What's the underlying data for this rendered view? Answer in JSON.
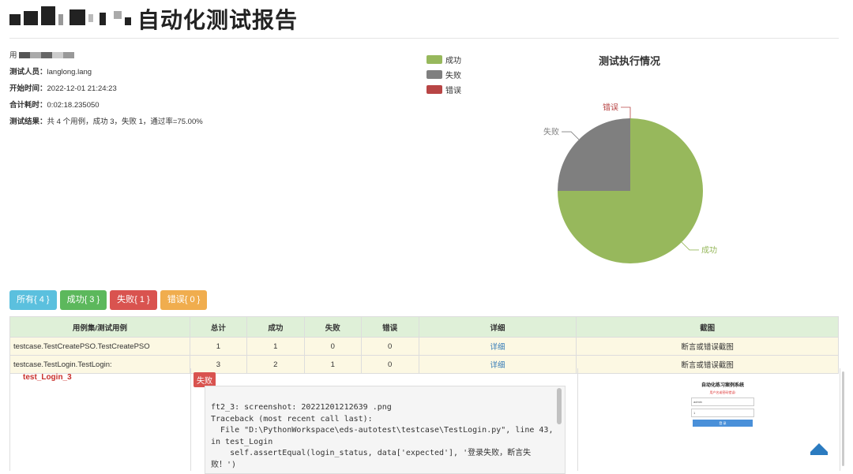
{
  "header": {
    "title": "自动化测试报告"
  },
  "info": {
    "project_label": "用",
    "tester_label": "测试人员：",
    "tester": "langlong.lang",
    "start_label": "开始时间：",
    "start_time": "2022-12-01 21:24:23",
    "duration_label": "合计耗时：",
    "duration": "0:02:18.235050",
    "result_label": "测试结果：",
    "result": "共 4 个用例，成功 3，失败 1，通过率=75.00%"
  },
  "chart_data": {
    "type": "pie",
    "title": "测试执行情况",
    "categories": [
      "成功",
      "失败",
      "错误"
    ],
    "values": [
      3,
      1,
      0
    ],
    "colors": [
      "#97b85c",
      "#7f7f7f",
      "#b84545"
    ],
    "legend": "top-left"
  },
  "filters": [
    {
      "label": "所有{ 4 }",
      "color": "#5bc0de"
    },
    {
      "label": "成功{ 3 }",
      "color": "#5cb85c"
    },
    {
      "label": "失败{ 1 }",
      "color": "#d9534f"
    },
    {
      "label": "错误{ 0 }",
      "color": "#f0ad4e"
    }
  ],
  "table": {
    "headers": [
      "用例集/测试用例",
      "总计",
      "成功",
      "失败",
      "错误",
      "详细",
      "截图"
    ],
    "rows": [
      {
        "name": "testcase.TestCreatePSO.TestCreatePSO",
        "total": "1",
        "pass": "1",
        "fail": "0",
        "error": "0",
        "detail": "详细",
        "shot": "断言或错误截图"
      },
      {
        "name": "testcase.TestLogin.TestLogin:",
        "total": "3",
        "pass": "2",
        "fail": "1",
        "error": "0",
        "detail": "详细",
        "shot": "断言或错误截图"
      }
    ]
  },
  "detail": {
    "case": "test_Login_3",
    "status": "失败",
    "trace_lines": [
      "ft2_3: screenshot: 20221201212639 .png",
      "Traceback (most recent call last):",
      "  File \"D:\\PythonWorkspace\\eds-autotest\\testcase\\TestLogin.py\", line 43,",
      "in test_Login",
      "    self.assertEqual(login_status, data['expected'], '登录失败，断言失",
      "败！')"
    ],
    "screenshot": {
      "title": "自动化练习案例系统",
      "subtitle": "用户名或密码错误!",
      "username": "admin",
      "password": "1",
      "button": "登 录"
    }
  }
}
